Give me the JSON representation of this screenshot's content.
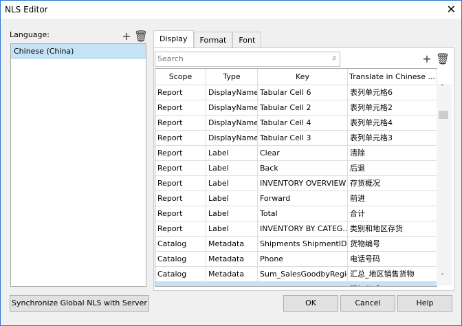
{
  "window": {
    "title": "NLS Editor",
    "close_icon": "close-icon"
  },
  "language": {
    "label": "Language:",
    "items": [
      "Chinese (China)"
    ]
  },
  "tabs": [
    "Display",
    "Format",
    "Font"
  ],
  "search": {
    "placeholder": "Search"
  },
  "table": {
    "columns": [
      "Scope",
      "Type",
      "Key",
      "Translate in Chinese ..."
    ],
    "rows": [
      [
        "Report",
        "DisplayName",
        "Tabular Cell 6",
        "表列单元格6"
      ],
      [
        "Report",
        "DisplayName",
        "Tabular Cell 2",
        "表列单元格2"
      ],
      [
        "Report",
        "DisplayName",
        "Tabular Cell 4",
        "表列单元格4"
      ],
      [
        "Report",
        "DisplayName",
        "Tabular Cell 3",
        "表列单元格3"
      ],
      [
        "Report",
        "Label",
        "Clear",
        "清除"
      ],
      [
        "Report",
        "Label",
        "Back",
        "后退"
      ],
      [
        "Report",
        "Label",
        "INVENTORY OVERVIEW",
        "存货概况"
      ],
      [
        "Report",
        "Label",
        "Forward",
        "前进"
      ],
      [
        "Report",
        "Label",
        "Total",
        "合计"
      ],
      [
        "Report",
        "Label",
        "INVENTORY BY CATEG...",
        "类别和地区存货"
      ],
      [
        "Catalog",
        "Metadata",
        "Shipments ShipmentID",
        "货物编号"
      ],
      [
        "Catalog",
        "Metadata",
        "Phone",
        "电话号码"
      ],
      [
        "Catalog",
        "Metadata",
        "Sum_SalesGoodbyRegion",
        "汇总_地区销售货物"
      ],
      [
        "Report",
        "Metadata",
        "Add Formula",
        "添加公式"
      ]
    ]
  },
  "buttons": {
    "sync": "Synchronize Global NLS with Server",
    "ok": "OK",
    "cancel": "Cancel",
    "help": "Help"
  }
}
